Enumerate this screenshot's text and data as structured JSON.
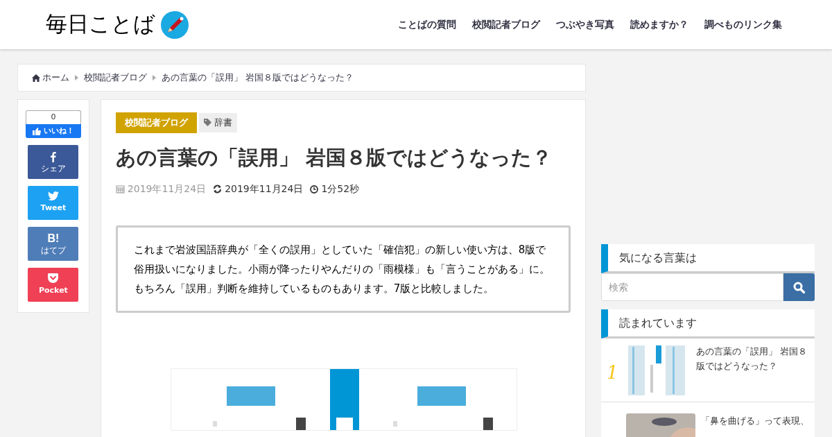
{
  "site": {
    "logo": "毎日ことば"
  },
  "nav": [
    "ことばの質問",
    "校閲記者ブログ",
    "つぶやき写真",
    "読めますか？",
    "調べものリンク集"
  ],
  "breadcrumb": [
    "ホーム",
    "校閲記者ブログ",
    "あの言葉の「誤用」 岩国８版ではどうなった？"
  ],
  "share": [
    {
      "kind": "like",
      "count": "0",
      "label": "いいね！"
    },
    {
      "kind": "facebook",
      "label": "シェア"
    },
    {
      "kind": "twitter",
      "label": "Tweet"
    },
    {
      "kind": "hatena",
      "icon_text": "B!",
      "label": "はてブ"
    },
    {
      "kind": "pocket",
      "label": "Pocket"
    }
  ],
  "article": {
    "category": "校閲記者ブログ",
    "tag": "辞書",
    "title": "あの言葉の「誤用」 岩国８版ではどうなった？",
    "published": "2019年11月24日",
    "updated": "2019年11月24日",
    "reading_time": "1分52秒",
    "summary": "これまで岩波国語辞典が「全くの誤用」としていた「確信犯」の新しい使い方は、8版で俗用扱いになりました。小雨が降ったりやんだりの「雨模様」も「言うことがある」に。もちろん「誤用」判断を維持しているものもあります。7版と比較しました。"
  },
  "sidebar": {
    "search_title": "気になる言葉は",
    "search": {
      "placeholder": "検索"
    },
    "popular_title": "読まれています",
    "popular": [
      {
        "rank": "1",
        "title": "あの言葉の「誤用」 岩国８版ではどうなった？"
      },
      {
        "title": "「鼻を曲げる」って表現、"
      }
    ]
  }
}
